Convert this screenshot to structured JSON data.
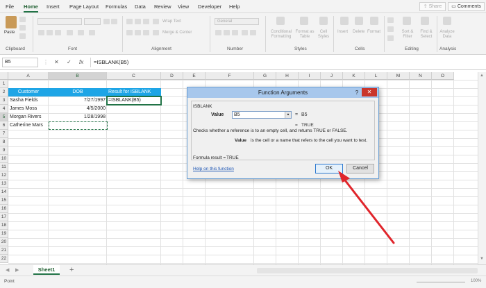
{
  "menu": {
    "tabs": [
      "File",
      "Home",
      "Insert",
      "Page Layout",
      "Formulas",
      "Data",
      "Review",
      "View",
      "Developer",
      "Help"
    ],
    "active": "Home",
    "share": "Share",
    "comments": "Comments"
  },
  "ribbon": {
    "paste": "Paste",
    "groups": {
      "clipboard": "Clipboard",
      "font": "Font",
      "alignment": "Alignment",
      "number": "Number",
      "styles": "Styles",
      "cells": "Cells",
      "editing": "Editing",
      "analysis": "Analysis"
    },
    "wrap_text": "Wrap Text",
    "merge_center": "Merge & Center",
    "number_format": "General",
    "conditional_formatting": "Conditional Formatting",
    "format_as_table": "Format as Table",
    "cell_styles": "Cell Styles",
    "insert": "Insert",
    "delete": "Delete",
    "format": "Format",
    "sort_filter": "Sort & Filter",
    "find_select": "Find & Select",
    "analyze_data": "Analyze Data"
  },
  "formula_bar": {
    "name_box": "B5",
    "cancel": "✕",
    "enter": "✓",
    "fx": "fx",
    "formula": "=ISBLANK(B5)"
  },
  "grid": {
    "columns": [
      "A",
      "B",
      "C",
      "D",
      "E",
      "F",
      "G",
      "H",
      "I",
      "J",
      "K",
      "L",
      "M",
      "N",
      "O"
    ],
    "rows": [
      "1",
      "2",
      "3",
      "4",
      "5",
      "6",
      "7",
      "8",
      "9",
      "10",
      "11",
      "12",
      "13",
      "14",
      "15",
      "16",
      "17",
      "18",
      "19",
      "20",
      "21",
      "22"
    ],
    "header_row": [
      "Customer",
      "DOB",
      "Result for ISBLANK"
    ],
    "data": [
      {
        "customer": "Sasha Fields",
        "dob": "7/27/1997",
        "result": "=ISBLANK(B5)"
      },
      {
        "customer": "James Moss",
        "dob": "4/5/2000",
        "result": ""
      },
      {
        "customer": "Morgan  Rivers",
        "dob": "1/28/1998",
        "result": ""
      },
      {
        "customer": "Catherine Mars",
        "dob": "",
        "result": ""
      }
    ]
  },
  "sheets": {
    "active": "Sheet1",
    "add": "+"
  },
  "status": {
    "mode": "Point",
    "zoom": "100%"
  },
  "dialog": {
    "title": "Function Arguments",
    "help_icon": "?",
    "close_icon": "✕",
    "function_name": "ISBLANK",
    "arg_label": "Value",
    "arg_value": "B5",
    "arg_eq": "=",
    "arg_result": "B5",
    "result_eq": "=",
    "result": "TRUE",
    "description": "Checks whether a reference is to an empty cell, and returns TRUE or FALSE.",
    "arg_help_label": "Value",
    "arg_help": "is the cell or a name that refers to the cell you want to test.",
    "formula_result_label": "Formula result =",
    "formula_result": "TRUE",
    "help_link": "Help on this function",
    "ok": "OK",
    "cancel": "Cancel"
  },
  "colors": {
    "accent": "#217346",
    "header_fill": "#1ea5e6",
    "dialog_title": "#a7c7ec",
    "close_red": "#c9352b",
    "arrow_red": "#e0252b"
  }
}
